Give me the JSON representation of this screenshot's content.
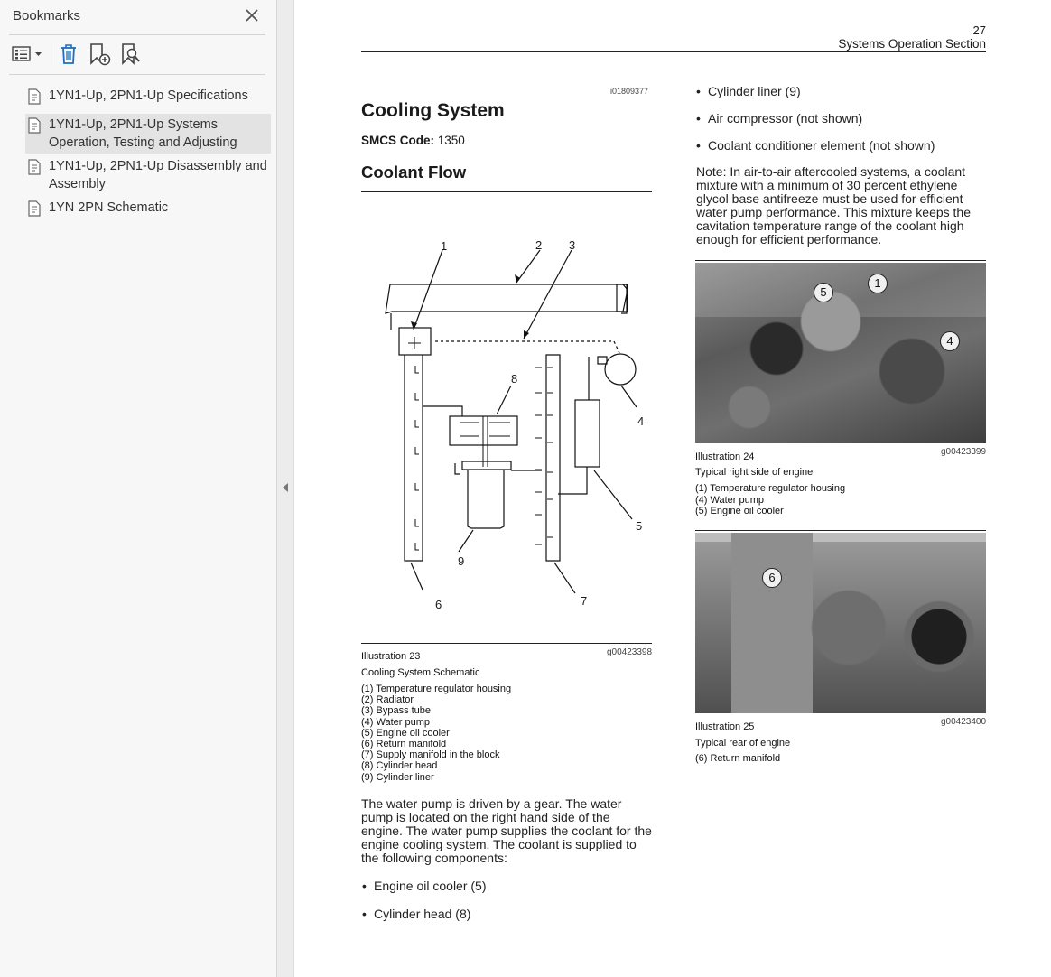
{
  "sidebar": {
    "title": "Bookmarks",
    "close_icon": "close-icon",
    "toolbar": {
      "options_icon": "bookmark-options-icon",
      "delete_icon": "trash-icon",
      "new_bookmark_icon": "add-bookmark-icon",
      "find_icon": "find-bookmark-icon"
    },
    "items": [
      {
        "label": "1YN1-Up, 2PN1-Up Specifications",
        "selected": false
      },
      {
        "label": "1YN1-Up, 2PN1-Up Systems Operation, Testing and Adjusting",
        "selected": true
      },
      {
        "label": "1YN1-Up, 2PN1-Up Disassembly and Assembly",
        "selected": false
      },
      {
        "label": "1YN 2PN Schematic",
        "selected": false
      }
    ]
  },
  "page": {
    "number": "27",
    "section": "Systems Operation Section",
    "doc_id": "i01809377",
    "title": "Cooling System",
    "smcs_label": "SMCS Code:",
    "smcs_value": "1350",
    "subtitle": "Coolant Flow",
    "ill23": {
      "title": "Illustration 23",
      "code": "g00423398",
      "caption": "Cooling System Schematic",
      "labels": [
        "1",
        "2",
        "3",
        "4",
        "5",
        "6",
        "7",
        "8",
        "9"
      ],
      "legend": [
        "(1) Temperature regulator housing",
        "(2) Radiator",
        "(3) Bypass tube",
        "(4) Water pump",
        "(5) Engine oil cooler",
        "(6) Return manifold",
        "(7) Supply manifold in the block",
        "(8) Cylinder head",
        "(9) Cylinder liner"
      ]
    },
    "body_text": "The water pump is driven by a gear. The water pump is located on the right hand side of the engine. The water pump supplies the coolant for the engine cooling system. The coolant is supplied to the following components:",
    "bullets_left": [
      "Engine oil cooler (5)",
      "Cylinder head (8)"
    ],
    "bullets_right": [
      "Cylinder liner (9)",
      "Air compressor (not shown)",
      "Coolant conditioner element (not shown)"
    ],
    "note_label": "Note:",
    "note_text": " In air-to-air aftercooled systems, a coolant mixture with a minimum of 30 percent ethylene glycol base antifreeze must be used for efficient water pump performance. This mixture keeps the cavitation temperature range of the coolant high enough for efficient performance.",
    "ill24": {
      "title": "Illustration 24",
      "code": "g00423399",
      "caption": "Typical right side of engine",
      "callouts": [
        "1",
        "4",
        "5"
      ],
      "legend": [
        "(1) Temperature regulator housing",
        "(4) Water pump",
        "(5) Engine oil cooler"
      ]
    },
    "ill25": {
      "title": "Illustration 25",
      "code": "g00423400",
      "caption": "Typical rear of engine",
      "callouts": [
        "6"
      ],
      "legend": [
        "(6) Return manifold"
      ]
    }
  }
}
